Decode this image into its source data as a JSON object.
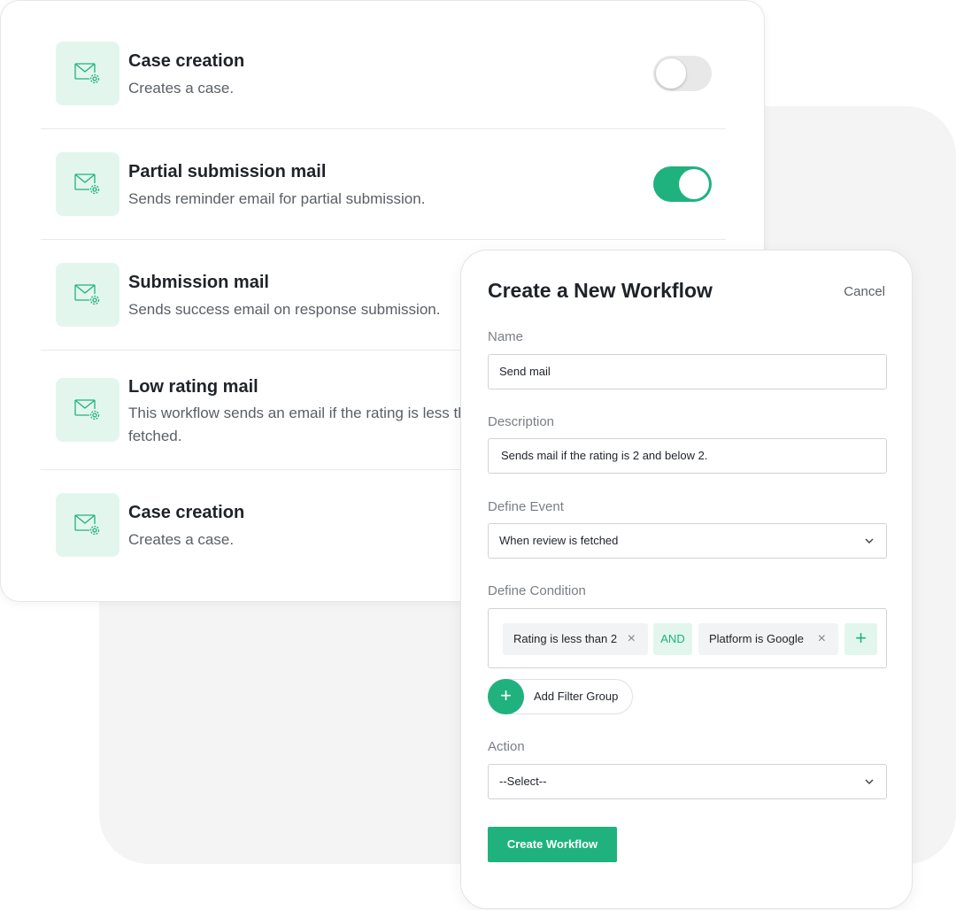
{
  "colors": {
    "accent": "#1fb27f",
    "accent_light": "#e3f6ee",
    "toggle_off": "#e8e8e8"
  },
  "workflows": [
    {
      "title": "Case creation",
      "description": "Creates a case.",
      "icon": "mail-gear-icon",
      "toggle": "off"
    },
    {
      "title": "Partial submission mail",
      "description": "Sends reminder email for partial submission.",
      "icon": "mail-gear-icon",
      "toggle": "on"
    },
    {
      "title": "Submission mail",
      "description": "Sends success email on response submission.",
      "icon": "mail-gear-icon"
    },
    {
      "title": "Low rating mail",
      "description": "This workflow sends an email if the rating is less than 2 when the review is fetched.",
      "icon": "mail-gear-icon"
    },
    {
      "title": "Case creation",
      "description": "Creates a case.",
      "icon": "mail-gear-icon"
    }
  ],
  "form": {
    "title": "Create a New Workflow",
    "cancel_label": "Cancel",
    "name_label": "Name",
    "name_value": "Send mail",
    "description_label": "Description",
    "description_value": "Sends mail if the rating is 2 and below 2.",
    "event_label": "Define Event",
    "event_value": "When review is fetched",
    "condition_label": "Define Condition",
    "conditions": [
      {
        "text": "Rating is less than 2"
      },
      {
        "text": "Platform is Google"
      }
    ],
    "condition_operator": "AND",
    "add_condition_symbol": "+",
    "add_filter_group_label": "Add Filter Group",
    "add_filter_group_symbol": "+",
    "remove_symbol": "×",
    "action_label": "Action",
    "action_value": "--Select--",
    "submit_label": "Create Workflow"
  }
}
